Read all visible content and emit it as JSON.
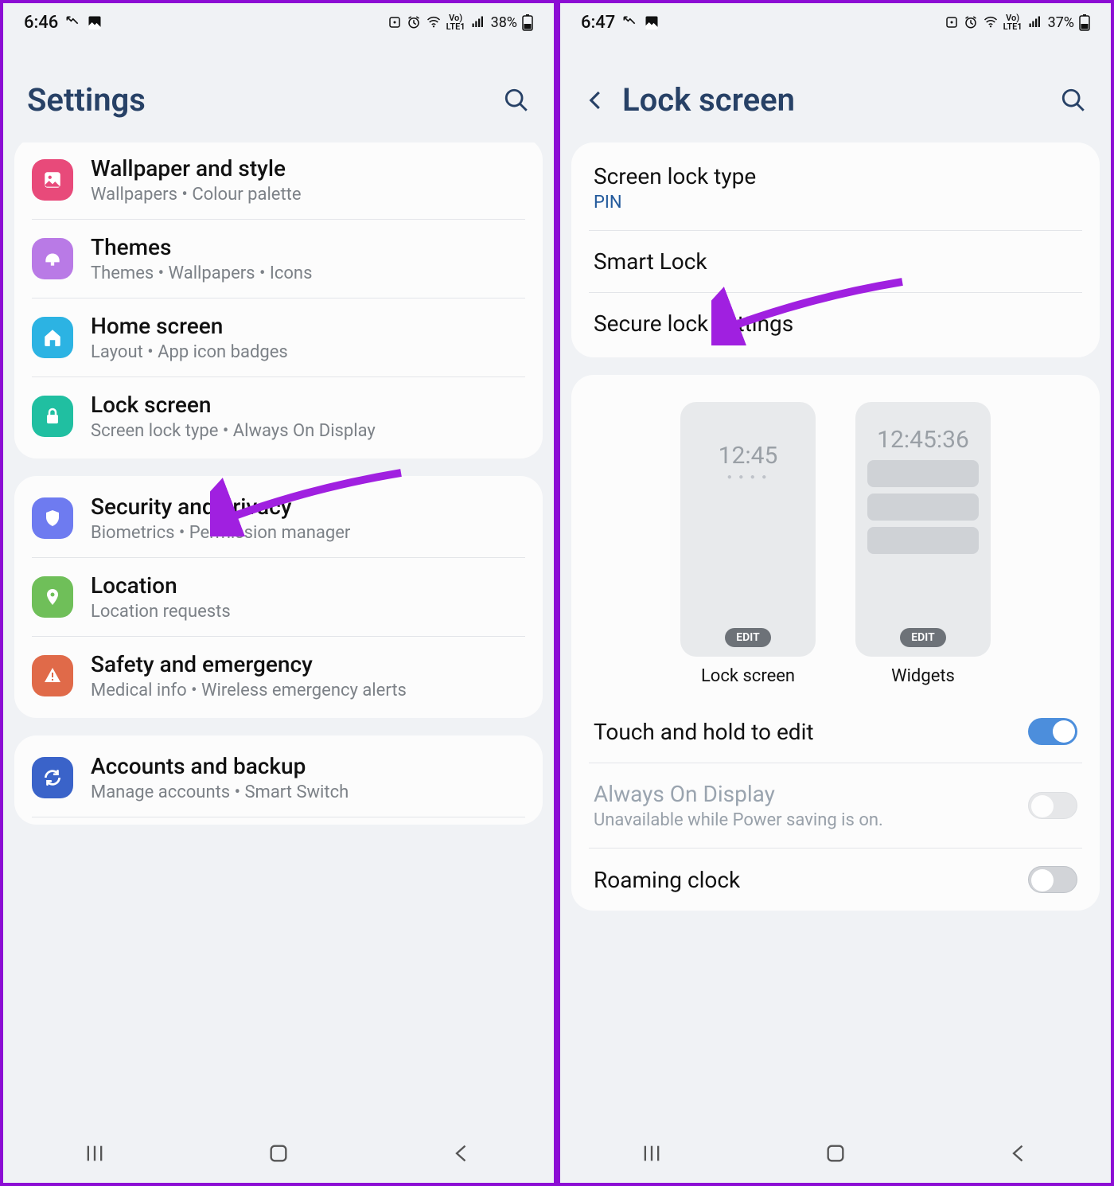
{
  "left": {
    "status": {
      "time": "6:46",
      "battery": "38%"
    },
    "title": "Settings",
    "groups": [
      {
        "items": [
          {
            "icon": "wallpaper",
            "color": "#e84a7a",
            "title": "Wallpaper and style",
            "sub": "Wallpapers  •  Colour palette"
          },
          {
            "icon": "themes",
            "color": "#b97ae6",
            "title": "Themes",
            "sub": "Themes  •  Wallpapers  •  Icons"
          },
          {
            "icon": "home",
            "color": "#2cb3e3",
            "title": "Home screen",
            "sub": "Layout  •  App icon badges"
          },
          {
            "icon": "lock",
            "color": "#20bfa1",
            "title": "Lock screen",
            "sub": "Screen lock type  •  Always On Display"
          }
        ]
      },
      {
        "items": [
          {
            "icon": "shield",
            "color": "#6e7bf0",
            "title": "Security and privacy",
            "sub": "Biometrics  •  Permission manager"
          },
          {
            "icon": "location",
            "color": "#6fbf59",
            "title": "Location",
            "sub": "Location requests"
          },
          {
            "icon": "safety",
            "color": "#e06a49",
            "title": "Safety and emergency",
            "sub": "Medical info  •  Wireless emergency alerts"
          }
        ]
      },
      {
        "items": [
          {
            "icon": "sync",
            "color": "#3a63c9",
            "title": "Accounts and backup",
            "sub": "Manage accounts  •  Smart Switch"
          }
        ]
      }
    ]
  },
  "right": {
    "status": {
      "time": "6:47",
      "battery": "37%"
    },
    "title": "Lock screen",
    "group1": [
      {
        "title": "Screen lock type",
        "sub": "PIN"
      },
      {
        "title": "Smart Lock"
      },
      {
        "title": "Secure lock settings"
      }
    ],
    "preview": {
      "lock": {
        "clock": "12:45",
        "edit": "EDIT",
        "caption": "Lock screen"
      },
      "widgets": {
        "clock": "12:45:36",
        "edit": "EDIT",
        "caption": "Widgets"
      }
    },
    "group2": [
      {
        "title": "Touch and hold to edit",
        "toggle": "on"
      },
      {
        "title": "Always On Display",
        "sub": "Unavailable while Power saving is on.",
        "toggle": "off",
        "disabled": true
      },
      {
        "title": "Roaming clock",
        "toggle": "off"
      }
    ]
  }
}
